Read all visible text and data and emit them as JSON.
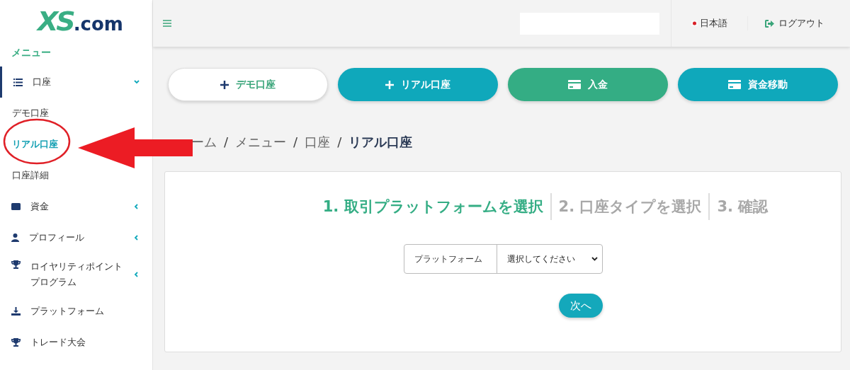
{
  "logo": {
    "mark": "XS",
    "suffix": ".com"
  },
  "sidebar": {
    "heading": "メニュー",
    "items": [
      {
        "label": "口座",
        "expanded": true,
        "selected": true,
        "children": [
          {
            "label": "デモ口座",
            "selected": false
          },
          {
            "label": "リアル口座",
            "selected": true
          },
          {
            "label": "口座詳細",
            "selected": false
          }
        ]
      },
      {
        "label": "資金",
        "expanded": false,
        "selected": false
      },
      {
        "label": "プロフィール",
        "expanded": false,
        "selected": false
      },
      {
        "label": "ロイヤリティポイントプログラム",
        "expanded": false,
        "selected": false
      },
      {
        "label": "プラットフォーム",
        "selected": false
      },
      {
        "label": "トレード大会",
        "selected": false
      }
    ]
  },
  "header": {
    "language": "日本語",
    "logout": "ログアウト"
  },
  "actions": [
    {
      "label": "デモ口座"
    },
    {
      "label": "リアル口座"
    },
    {
      "label": "入金"
    },
    {
      "label": "資金移動"
    }
  ],
  "breadcrumb": [
    {
      "label": "ーム"
    },
    {
      "separator": "/",
      "label": "メニュー"
    },
    {
      "separator": "/",
      "label": "口座"
    },
    {
      "separator": "/",
      "label": "リアル口座"
    }
  ],
  "steps": [
    {
      "label": "1. 取引プラットフォームを選択",
      "selected": true
    },
    {
      "label": "2. 口座タイプを選択",
      "selected": false
    },
    {
      "label": "3. 確認",
      "selected": false
    }
  ],
  "form": {
    "label": "プラットフォーム",
    "value": "選択してください"
  },
  "next_button": "次へ"
}
